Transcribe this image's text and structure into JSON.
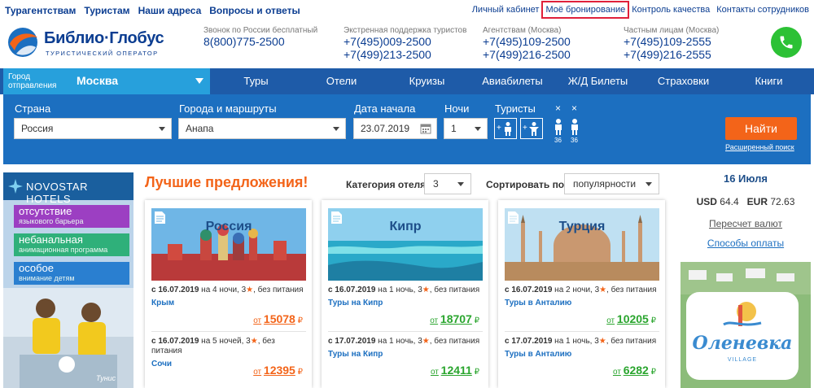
{
  "topnav": {
    "left": [
      "Турагентствам",
      "Туристам",
      "Наши адреса",
      "Вопросы и ответы"
    ],
    "right": [
      "Личный кабинет",
      "Моё бронирование",
      "Контроль качества",
      "Контакты сотрудников"
    ]
  },
  "header": {
    "brand": "Библио·Глобус",
    "tagline": "ТУРИСТИЧЕСКИЙ ОПЕРАТОР",
    "contacts": [
      {
        "label": "Звонок по России бесплатный",
        "phones": [
          "8(800)775-2500"
        ]
      },
      {
        "label": "Экстренная поддержка туристов",
        "phones": [
          "+7(495)009-2500",
          "+7(499)213-2500"
        ]
      },
      {
        "label": "Агентствам (Москва)",
        "phones": [
          "+7(495)109-2500",
          "+7(499)216-2500"
        ]
      },
      {
        "label": "Частным лицам (Москва)",
        "phones": [
          "+7(495)109-2555",
          "+7(499)216-2555"
        ]
      }
    ]
  },
  "mainnav": {
    "city_label": "Город отправления",
    "city_value": "Москва",
    "items": [
      "Туры",
      "Отели",
      "Круизы",
      "Авиабилеты",
      "Ж/Д Билеты",
      "Страховки",
      "Книги"
    ]
  },
  "search": {
    "country_label": "Страна",
    "country_value": "Россия",
    "cities_label": "Города и маршруты",
    "cities_value": "Анапа",
    "date_label": "Дата начала",
    "date_value": "23.07.2019",
    "nights_label": "Ночи",
    "nights_value": "1",
    "tourists_label": "Туристы",
    "plus": "+",
    "x": "×",
    "counts": [
      "36",
      "36"
    ],
    "find_button": "Найти",
    "advanced_link": "Расширенный поиск"
  },
  "banner": {
    "brand": "NOVOSTAR HOTELS",
    "pills": [
      {
        "t1": "отсутствие",
        "t2": "языкового барьера",
        "color": "#9c3fc2"
      },
      {
        "t1": "небанальная",
        "t2": "анимационная программа",
        "color": "#2fb07a"
      },
      {
        "t1": "особое",
        "t2": "внимание детям",
        "color": "#2a7fd0"
      }
    ],
    "caption": "Тунис"
  },
  "offers": {
    "title": "Лучшие предложения!",
    "category_label": "Категория отеля:",
    "category_value": "3",
    "sort_label": "Сортировать по:",
    "sort_value": "популярности",
    "cards": [
      {
        "country": "Россия",
        "items": [
          {
            "date": "с 16.07.2019",
            "rest": " на 4 ночи, 3",
            "meal": ", без питания",
            "dest": "Крым",
            "from": "от",
            "price": "15078",
            "currency": "₽",
            "color": "orange"
          },
          {
            "date": "с 16.07.2019",
            "rest": " на 5 ночей, 3",
            "meal": ", без питания",
            "dest": "Сочи",
            "from": "от",
            "price": "12395",
            "currency": "₽",
            "color": "orange"
          }
        ]
      },
      {
        "country": "Кипр",
        "items": [
          {
            "date": "с 16.07.2019",
            "rest": " на 1 ночь, 3",
            "meal": ", без питания",
            "dest": "Туры на Кипр",
            "from": "от",
            "price": "18707",
            "currency": "₽",
            "color": "green"
          },
          {
            "date": "с 17.07.2019",
            "rest": " на 1 ночь, 3",
            "meal": ", без питания",
            "dest": "Туры на Кипр",
            "from": "от",
            "price": "12411",
            "currency": "₽",
            "color": "green"
          }
        ]
      },
      {
        "country": "Турция",
        "items": [
          {
            "date": "с 16.07.2019",
            "rest": " на 2 ночи, 3",
            "meal": ", без питания",
            "dest": "Туры в Анталию",
            "from": "от",
            "price": "10205",
            "currency": "₽",
            "color": "green"
          },
          {
            "date": "с 17.07.2019",
            "rest": " на 1 ночь, 3",
            "meal": ", без питания",
            "dest": "Туры в Анталию",
            "from": "от",
            "price": "6282",
            "currency": "₽",
            "color": "green"
          }
        ]
      }
    ]
  },
  "sidebar": {
    "date": "16 Июля",
    "usd_label": "USD",
    "usd": "64.4",
    "eur_label": "EUR",
    "eur": "72.63",
    "recalc": "Пересчет валют",
    "payment": "Способы оплаты",
    "ad_title": "Оленевка",
    "ad_subtitle": "VILLAGE"
  },
  "colors": {
    "brand_blue": "#0b3d91",
    "nav_blue": "#1e5ba8",
    "accent_orange": "#f36419",
    "price_green": "#2aa52e",
    "call_green": "#2cc135",
    "highlight_red": "#e0203a"
  }
}
